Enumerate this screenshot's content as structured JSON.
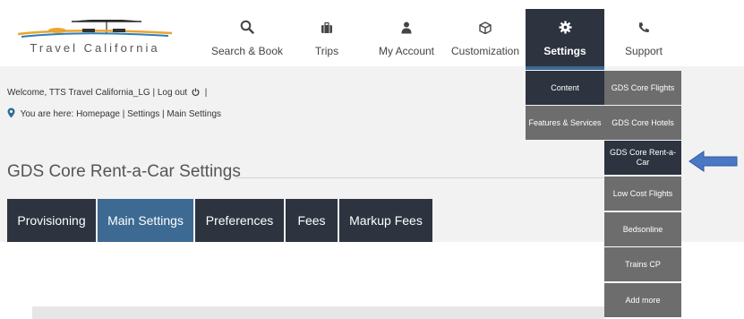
{
  "brand": {
    "logo_text": "Travel California"
  },
  "nav": [
    {
      "label": "Search & Book",
      "icon": "search-icon"
    },
    {
      "label": "Trips",
      "icon": "suitcase-icon"
    },
    {
      "label": "My Account",
      "icon": "user-icon"
    },
    {
      "label": "Customization",
      "icon": "cube-icon"
    },
    {
      "label": "Settings",
      "icon": "gear-icon"
    },
    {
      "label": "Support",
      "icon": "phone-icon"
    }
  ],
  "header": {
    "welcome": "Welcome, TTS Travel California_LG  |  Log out",
    "welcome_sep": "|",
    "breadcrumb": "You are here: Homepage | Settings | Main Settings"
  },
  "page": {
    "title": "GDS Core Rent-a-Car Settings"
  },
  "tabs": [
    {
      "label": "Provisioning"
    },
    {
      "label": "Main Settings"
    },
    {
      "label": "Preferences"
    },
    {
      "label": "Fees"
    },
    {
      "label": "Markup Fees"
    }
  ],
  "settings_menu": {
    "categories": [
      {
        "label": "Content"
      },
      {
        "label": "Features & Services"
      }
    ],
    "items": [
      {
        "label": "GDS Core Flights"
      },
      {
        "label": "GDS Core Hotels"
      },
      {
        "label": "GDS Core Rent-a-Car"
      },
      {
        "label": "Low Cost Flights"
      },
      {
        "label": "Bedsonline"
      },
      {
        "label": "Trains CP"
      },
      {
        "label": "Add more"
      }
    ]
  },
  "colors": {
    "nav_dark": "#2d3440",
    "active_blue": "#3d6a92",
    "menu_grey": "#6d6d6d",
    "arrow_blue": "#4a78c4"
  }
}
